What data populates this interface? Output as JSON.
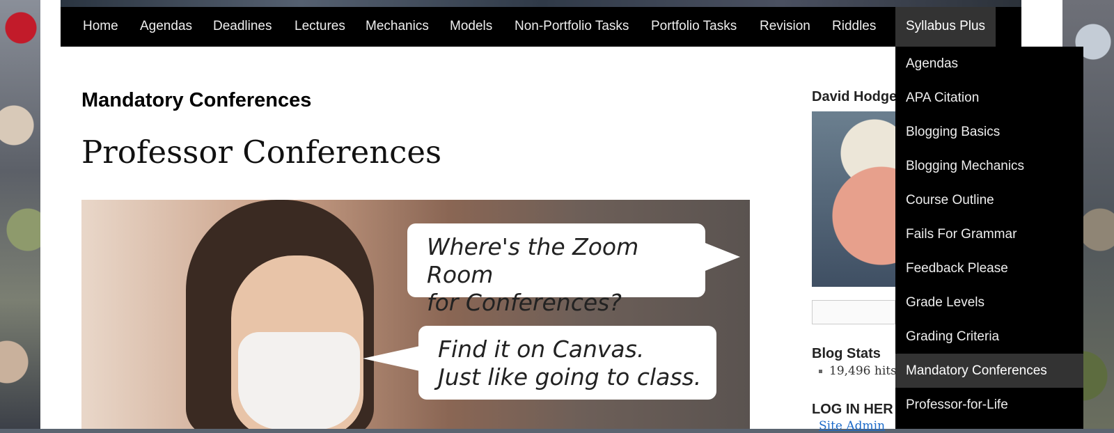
{
  "nav": {
    "items": [
      {
        "label": "Home"
      },
      {
        "label": "Agendas"
      },
      {
        "label": "Deadlines"
      },
      {
        "label": "Lectures"
      },
      {
        "label": "Mechanics"
      },
      {
        "label": "Models"
      },
      {
        "label": "Non-Portfolio Tasks"
      },
      {
        "label": "Portfolio Tasks"
      },
      {
        "label": "Revision"
      },
      {
        "label": "Riddles"
      },
      {
        "label": "Syllabus Plus"
      }
    ],
    "active": "Syllabus Plus"
  },
  "dropdown": {
    "items": [
      {
        "label": "Agendas"
      },
      {
        "label": "APA Citation"
      },
      {
        "label": "Blogging Basics"
      },
      {
        "label": "Blogging Mechanics"
      },
      {
        "label": "Course Outline"
      },
      {
        "label": "Fails For Grammar"
      },
      {
        "label": "Feedback Please"
      },
      {
        "label": "Grade Levels"
      },
      {
        "label": "Grading Criteria"
      },
      {
        "label": "Mandatory Conferences"
      },
      {
        "label": "Professor-for-Life"
      }
    ],
    "current": "Mandatory Conferences"
  },
  "main": {
    "title": "Mandatory Conferences",
    "heading": "Professor Conferences",
    "image": {
      "bubble1": "Where's the Zoom Room\nfor Conferences?",
      "bubble2": "Find it on Canvas.\nJust like going to class."
    }
  },
  "sidebar": {
    "author_name": "David Hodge",
    "blog_stats": {
      "title": "Blog Stats",
      "hits": "19,496 hits"
    },
    "login": {
      "title": "LOG IN HER",
      "link": "Site Admin"
    }
  }
}
